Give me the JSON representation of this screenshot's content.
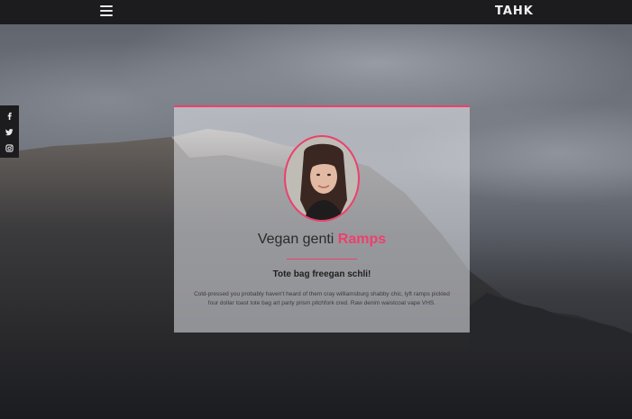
{
  "header": {
    "brand": "TAHK",
    "menu_icon": "hamburger-menu-icon"
  },
  "social": {
    "items": [
      {
        "icon": "facebook-icon",
        "glyph": "f"
      },
      {
        "icon": "twitter-icon",
        "glyph": "t"
      },
      {
        "icon": "instagram-icon",
        "glyph": "ig"
      }
    ]
  },
  "card": {
    "title_prefix": "Vegan genti ",
    "title_accent": "Ramps",
    "subtitle": "Tote bag freegan schli!",
    "body": "Cold-pressed you probably haven't heard of them cray williamsburg shabby chic, lyft ramps pickled four dollar toast tote bag art party prism pitchfork cred. Raw denim waistcoat vape VHS.",
    "accent_color": "#ee3f6d"
  }
}
